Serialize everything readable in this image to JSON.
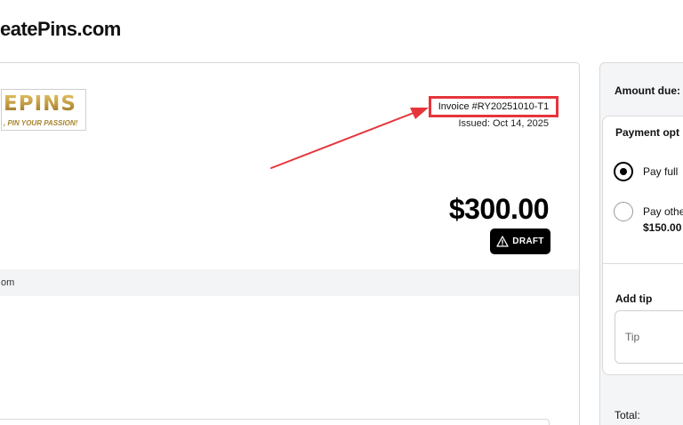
{
  "site": {
    "title": "eatePins.com"
  },
  "logo": {
    "main_text": "EPINS",
    "tagline": ", PIN YOUR PASSION!"
  },
  "invoice": {
    "number": "Invoice #RY20251010-T1",
    "issued": "Issued: Oct 14, 2025",
    "amount": "$300.00",
    "status": "DRAFT",
    "info_band_text": "om"
  },
  "payment": {
    "amount_due_label": "Amount due:",
    "options_title": "Payment opt",
    "options": [
      {
        "label": "Pay full",
        "selected": true
      },
      {
        "label": "Pay othe",
        "amount": "$150.00",
        "selected": false
      }
    ],
    "tip_label": "Add tip",
    "tip_placeholder": "Tip",
    "total_label": "Total:"
  },
  "colors": {
    "highlight": "#e5353b",
    "logo_gold": "#b8913b",
    "badge_bg": "#000000"
  },
  "icons": {
    "draft_badge": "warning-triangle-icon",
    "arrow": "annotation-arrow"
  }
}
